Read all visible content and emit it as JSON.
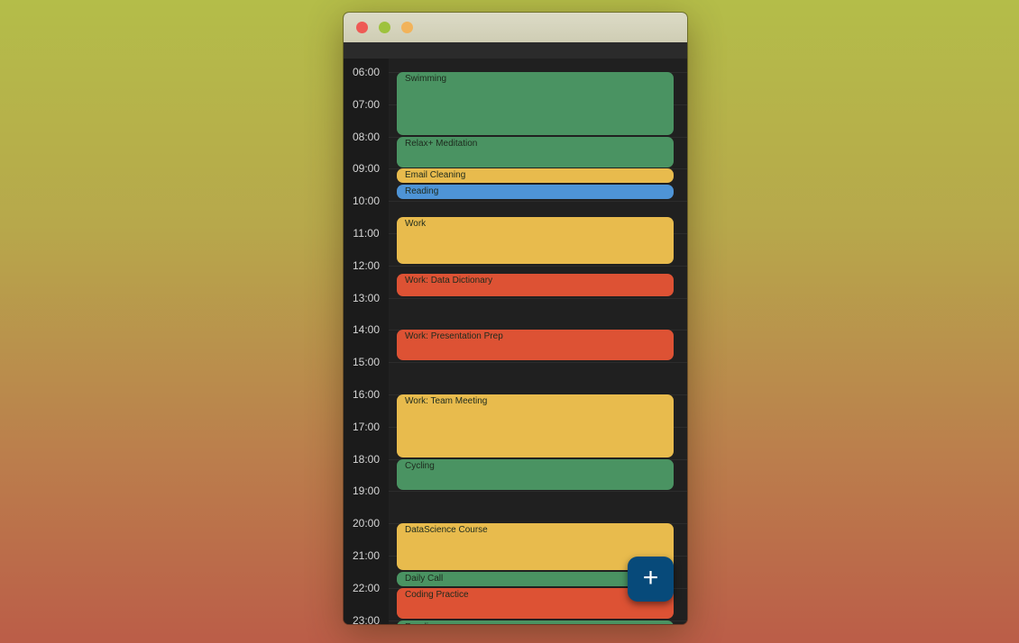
{
  "colors": {
    "green": "#4a9362",
    "yellow": "#e8bb4d",
    "red": "#dd5234",
    "blue": "#4e94d6",
    "fab": "#074a7a"
  },
  "hours": [
    "06:00",
    "07:00",
    "08:00",
    "09:00",
    "10:00",
    "11:00",
    "12:00",
    "13:00",
    "14:00",
    "15:00",
    "16:00",
    "17:00",
    "18:00",
    "19:00",
    "20:00",
    "21:00",
    "22:00",
    "23:00"
  ],
  "events": [
    {
      "title": "Swimming",
      "start": 6.0,
      "end": 7.95,
      "color": "green"
    },
    {
      "title": "Relax+ Meditation",
      "start": 8.0,
      "end": 8.95,
      "color": "green"
    },
    {
      "title": "Email Cleaning",
      "start": 9.0,
      "end": 9.45,
      "color": "yellow"
    },
    {
      "title": "Reading",
      "start": 9.5,
      "end": 9.95,
      "color": "blue"
    },
    {
      "title": "Work",
      "start": 10.5,
      "end": 11.95,
      "color": "yellow"
    },
    {
      "title": "Work: Data Dictionary",
      "start": 12.25,
      "end": 12.95,
      "color": "red"
    },
    {
      "title": "Work: Presentation Prep",
      "start": 14.0,
      "end": 14.95,
      "color": "red"
    },
    {
      "title": "Work: Team Meeting",
      "start": 16.0,
      "end": 17.95,
      "color": "yellow"
    },
    {
      "title": "Cycling",
      "start": 18.0,
      "end": 18.95,
      "color": "green"
    },
    {
      "title": "DataScience Course",
      "start": 20.0,
      "end": 21.45,
      "color": "yellow"
    },
    {
      "title": "Daily Call",
      "start": 21.5,
      "end": 21.95,
      "color": "green"
    },
    {
      "title": "Coding Practice",
      "start": 22.0,
      "end": 22.95,
      "color": "red"
    },
    {
      "title": "Reading",
      "start": 23.0,
      "end": 23.5,
      "color": "green"
    }
  ],
  "fab": {
    "icon": "plus-icon",
    "label": "+"
  }
}
